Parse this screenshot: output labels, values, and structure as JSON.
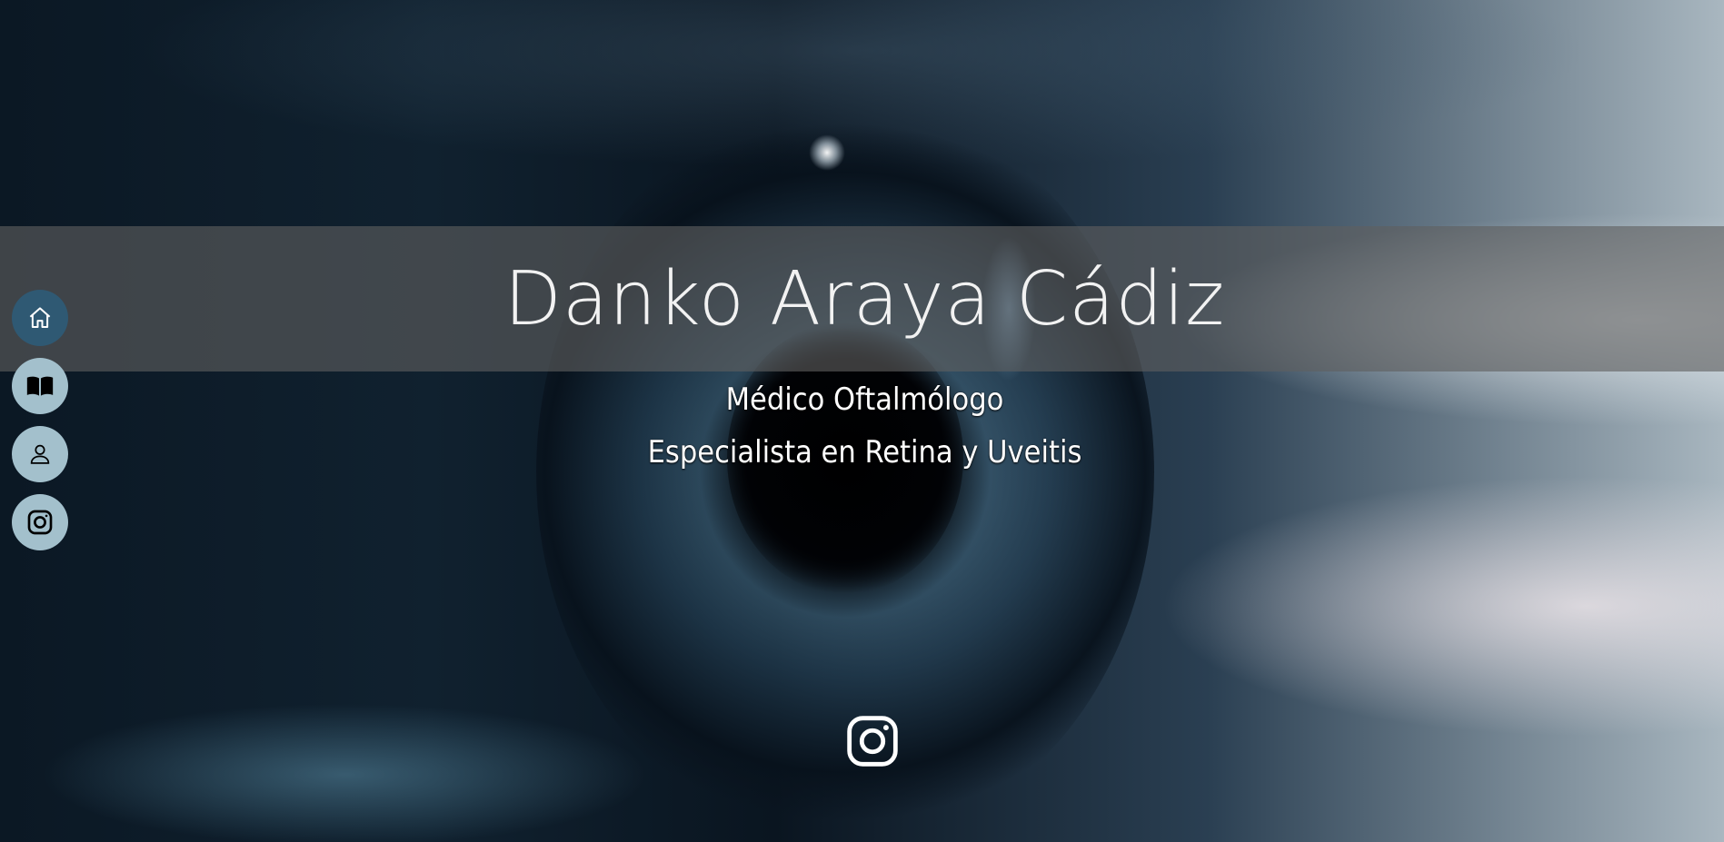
{
  "hero": {
    "name": "Danko Araya Cádiz",
    "subtitle_line1": "Médico Oftalmólogo",
    "subtitle_line2": "Especialista en Retina y Uveitis"
  },
  "side_nav": {
    "items": [
      {
        "icon": "home-icon",
        "active": true
      },
      {
        "icon": "book-icon",
        "active": false
      },
      {
        "icon": "user-icon",
        "active": false
      },
      {
        "icon": "instagram-icon",
        "active": false
      }
    ]
  },
  "social": {
    "icon": "instagram-icon"
  },
  "colors": {
    "nav_button": "#a3c0cc",
    "nav_button_active": "#2f5973",
    "title_band": "rgba(95,95,95,0.62)",
    "text": "#ffffff"
  }
}
